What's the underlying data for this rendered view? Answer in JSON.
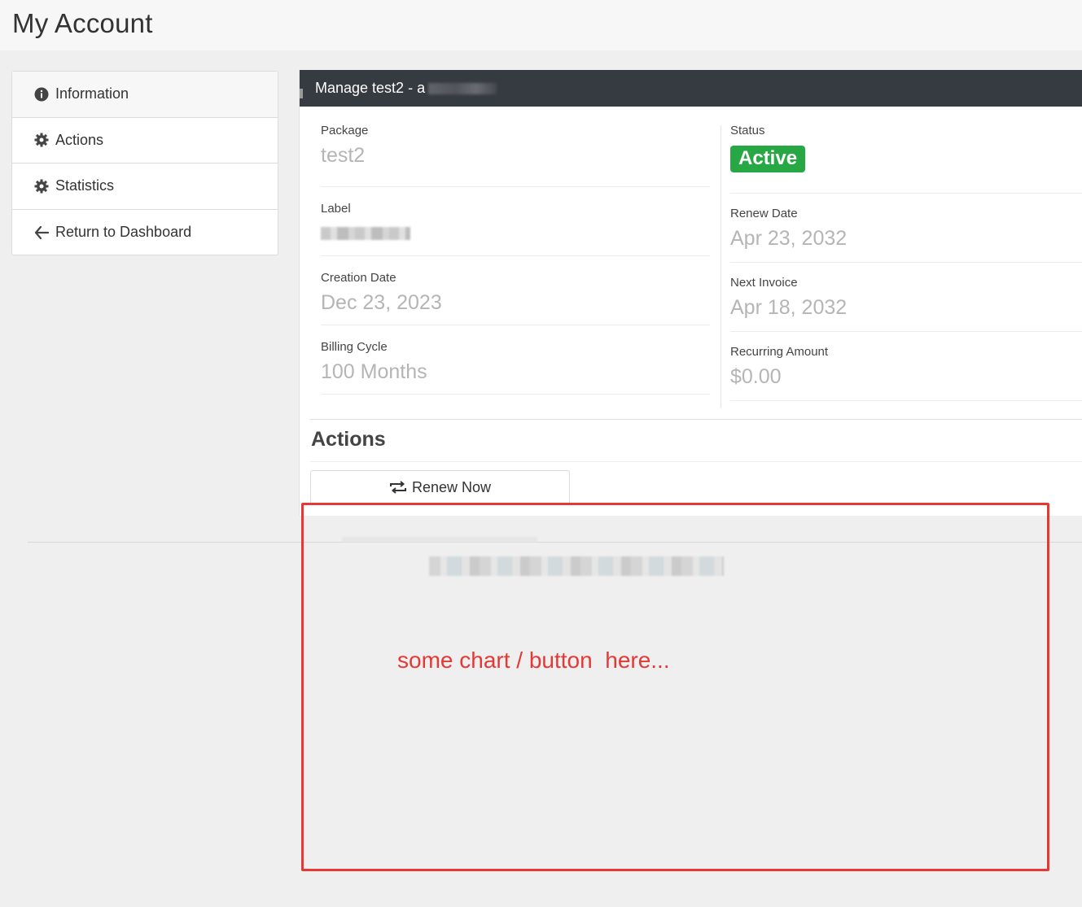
{
  "header": {
    "title": "My Account"
  },
  "sidebar": {
    "items": [
      {
        "label": "Information",
        "icon": "info-circle-icon"
      },
      {
        "label": "Actions",
        "icon": "gear-icon"
      },
      {
        "label": "Statistics",
        "icon": "gear-icon"
      },
      {
        "label": "Return to Dashboard",
        "icon": "arrow-left-icon"
      }
    ]
  },
  "panel": {
    "title": "Manage test2 - a",
    "left": [
      {
        "label": "Package",
        "value": "test2"
      },
      {
        "label": "Label",
        "value": ""
      },
      {
        "label": "Creation Date",
        "value": "Dec 23, 2023"
      },
      {
        "label": "Billing Cycle",
        "value": "100 Months"
      }
    ],
    "status": {
      "label": "Status",
      "value": "Active",
      "color": "#28a745"
    },
    "right": [
      {
        "label": "Renew Date",
        "value": "Apr 23, 2032"
      },
      {
        "label": "Next Invoice",
        "value": "Apr 18, 2032"
      },
      {
        "label": "Recurring Amount",
        "value": "$0.00"
      }
    ],
    "actions": {
      "title": "Actions",
      "renew_label": "Renew Now"
    }
  },
  "annotation": {
    "text": "some chart / button  here...",
    "color": "#e53935"
  }
}
